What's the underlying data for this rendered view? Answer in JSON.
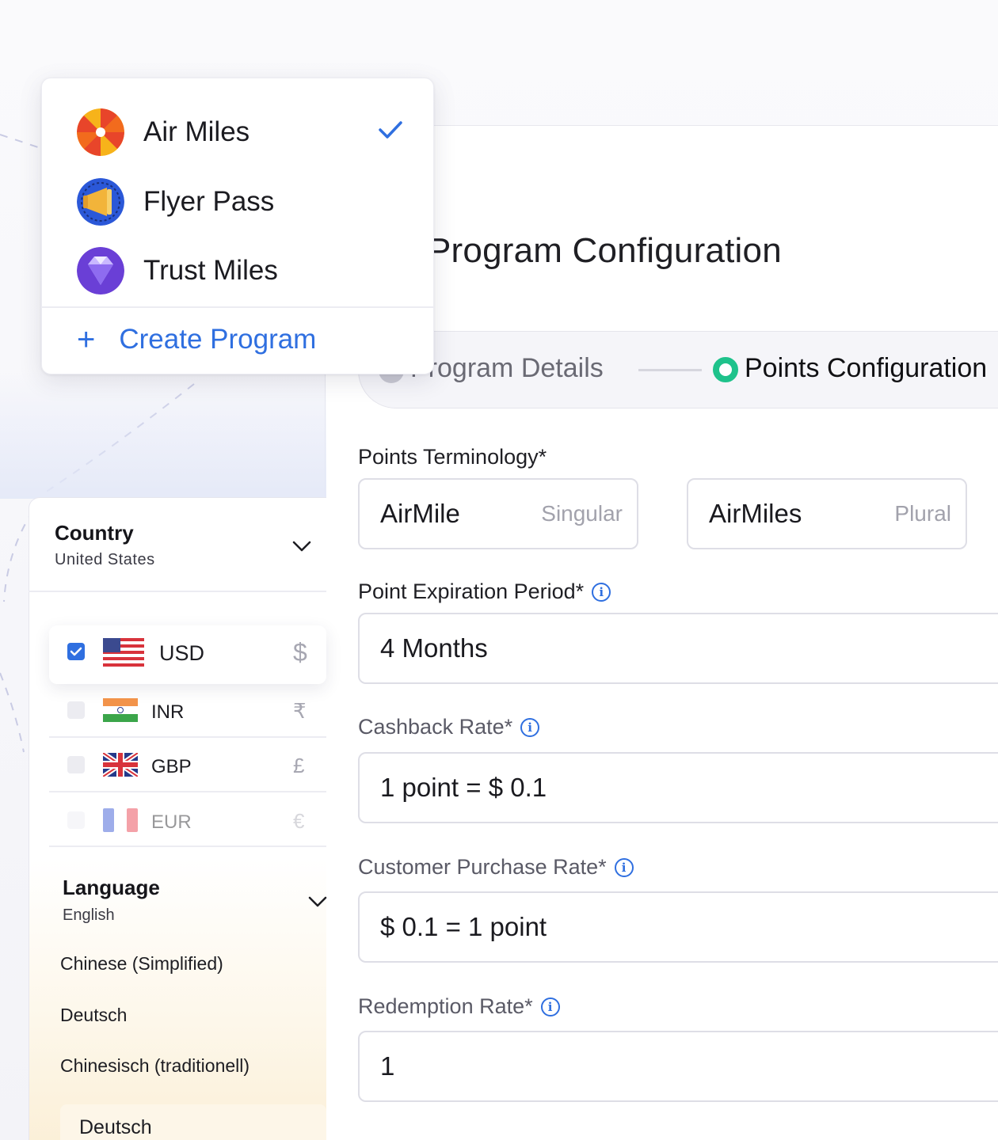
{
  "program_menu": {
    "items": [
      {
        "label": "Air Miles",
        "selected": true,
        "logo": "sunburst-logo"
      },
      {
        "label": "Flyer Pass",
        "selected": false,
        "logo": "megaphone-logo"
      },
      {
        "label": "Trust Miles",
        "selected": false,
        "logo": "diamond-logo"
      }
    ],
    "create_label": "Create Program"
  },
  "page": {
    "title": "Program Configuration"
  },
  "stepper": {
    "steps": [
      {
        "label": "Program Details",
        "state": "complete"
      },
      {
        "label": "Points Configuration",
        "state": "active"
      }
    ]
  },
  "form": {
    "terminology": {
      "label": "Points Terminology*",
      "singular_value": "AirMile",
      "singular_hint": "Singular",
      "plural_value": "AirMiles",
      "plural_hint": "Plural"
    },
    "expiration": {
      "label": "Point Expiration Period*",
      "value": "4 Months"
    },
    "cashback": {
      "label": "Cashback Rate*",
      "value": "1 point = $ 0.1"
    },
    "purchase": {
      "label": "Customer Purchase Rate*",
      "value": "$ 0.1 = 1 point"
    },
    "redemption": {
      "label": "Redemption Rate*",
      "value": "1"
    }
  },
  "settings": {
    "country": {
      "title": "Country",
      "value": "United States"
    },
    "currencies": [
      {
        "code": "USD",
        "symbol": "$",
        "checked": true
      },
      {
        "code": "INR",
        "symbol": "₹",
        "checked": false
      },
      {
        "code": "GBP",
        "symbol": "£",
        "checked": false
      },
      {
        "code": "EUR",
        "symbol": "€",
        "checked": false
      }
    ],
    "language": {
      "title": "Language",
      "value": "English",
      "options": [
        "Chinese (Simplified)",
        "Deutsch",
        "Chinesisch (traditionell)",
        "Deutsch"
      ]
    }
  },
  "colors": {
    "accent": "#2f6fe0",
    "step_active": "#1ec28b",
    "text_muted": "#a2a2ac"
  }
}
